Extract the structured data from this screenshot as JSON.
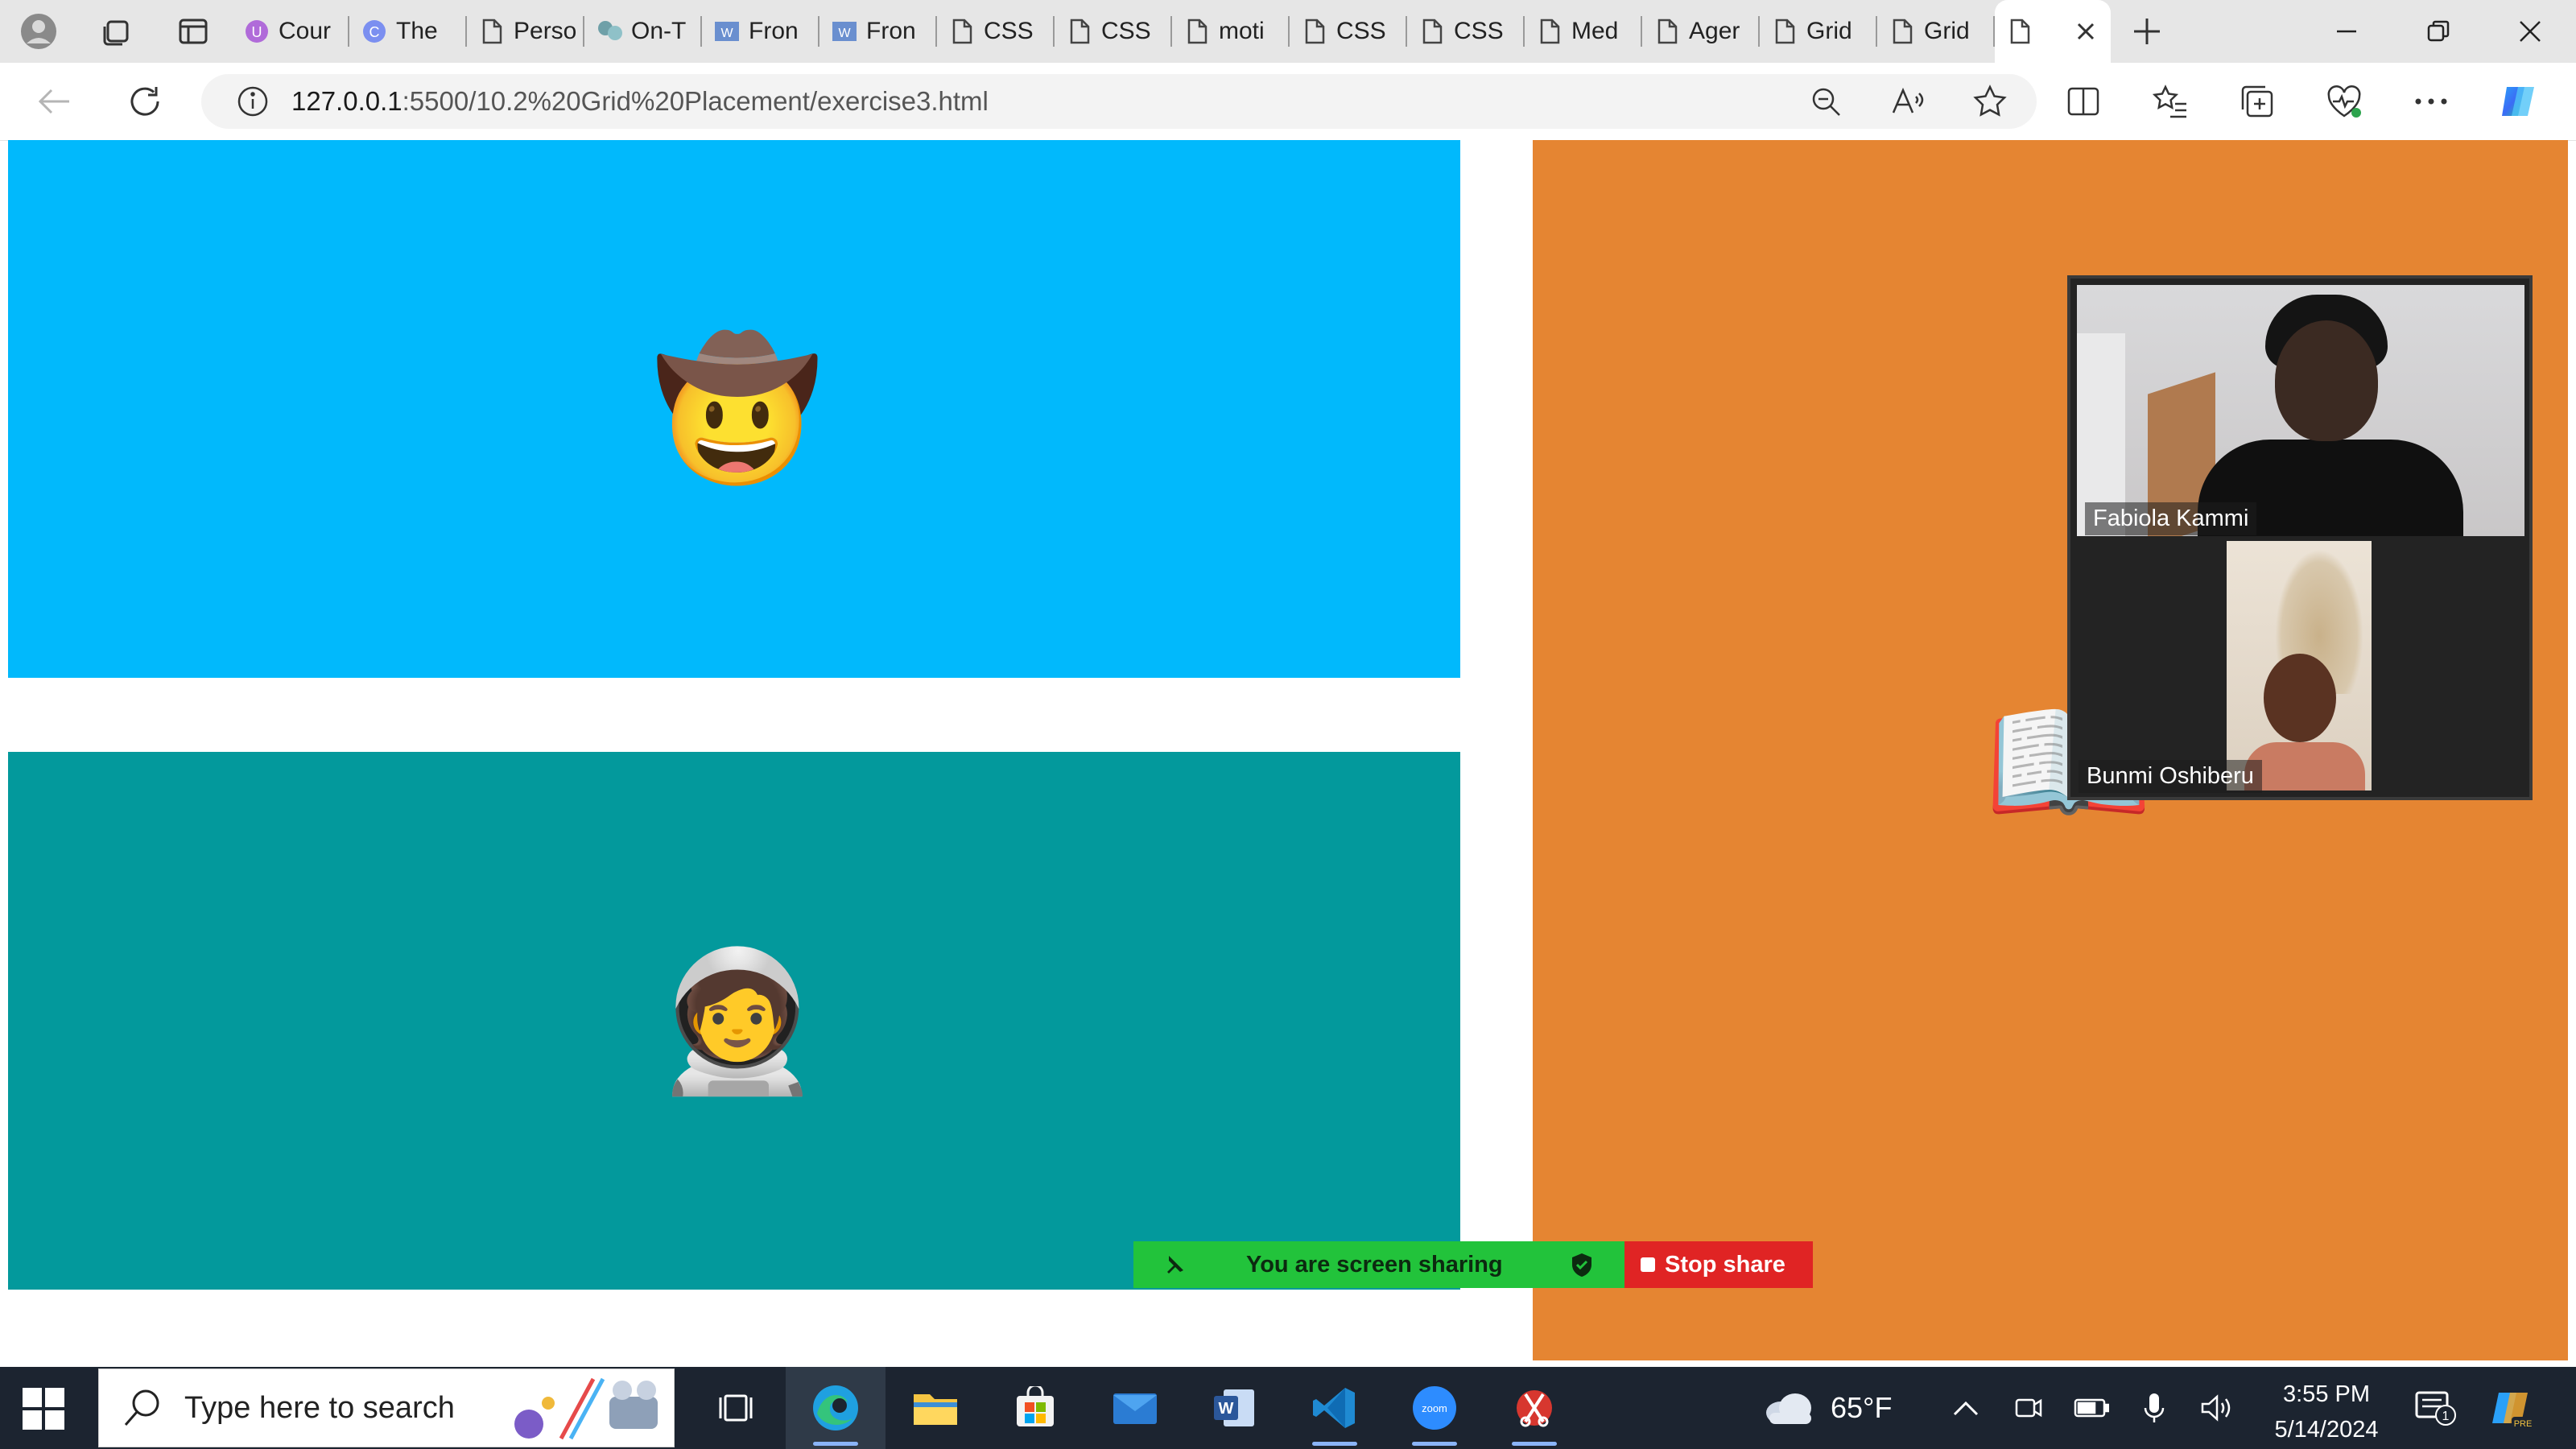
{
  "browser": {
    "tabs": [
      {
        "label": "Cour",
        "icon": "course-icon"
      },
      {
        "label": "The",
        "icon": "copilot-c-icon"
      },
      {
        "label": "Perso",
        "icon": "page-icon"
      },
      {
        "label": "On-T",
        "icon": "teams-icon"
      },
      {
        "label": "Fron",
        "icon": "word-icon"
      },
      {
        "label": "Fron",
        "icon": "word-icon"
      },
      {
        "label": "CSS",
        "icon": "page-icon"
      },
      {
        "label": "CSS",
        "icon": "page-icon"
      },
      {
        "label": "moti",
        "icon": "page-icon"
      },
      {
        "label": "CSS",
        "icon": "page-icon"
      },
      {
        "label": "CSS",
        "icon": "page-icon"
      },
      {
        "label": "Med",
        "icon": "page-icon"
      },
      {
        "label": "Ager",
        "icon": "page-icon"
      },
      {
        "label": "Grid",
        "icon": "page-icon"
      },
      {
        "label": "Grid",
        "icon": "page-icon"
      }
    ],
    "address": {
      "host": "127.0.0.1",
      "path": ":5500/10.2%20Grid%20Placement/exercise3.html"
    }
  },
  "page": {
    "panels": [
      {
        "name": "cowboy",
        "emoji": "🤠",
        "color": "#01b9fc"
      },
      {
        "name": "astronaut",
        "emoji": "🧑‍🚀",
        "color": "#03999c"
      },
      {
        "name": "book",
        "emoji": "📖",
        "color": "#e58532"
      }
    ]
  },
  "zoom": {
    "participants": [
      {
        "name": "Fabiola Kammi"
      },
      {
        "name": "Bunmi Oshiberu"
      }
    ],
    "share_bar": {
      "status": "You are screen sharing",
      "stop": "Stop share"
    }
  },
  "taskbar": {
    "search_placeholder": "Type here to search",
    "weather": "65°F",
    "time": "3:55 PM",
    "date": "5/14/2024",
    "notification_count": "1"
  }
}
